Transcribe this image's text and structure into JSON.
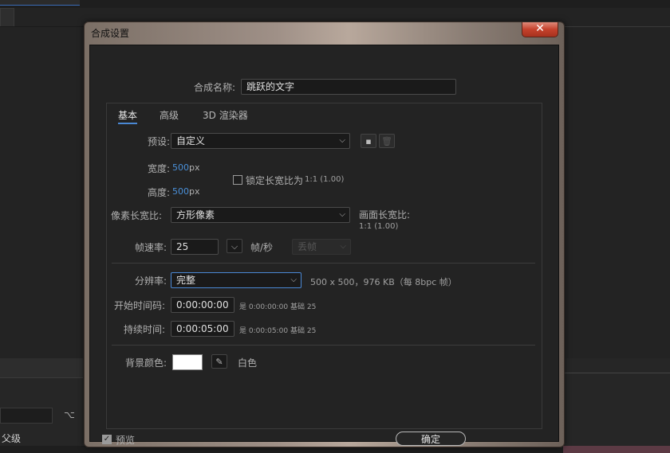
{
  "background": {
    "parent_label": "父级"
  },
  "dialog": {
    "title": "合成设置",
    "close_glyph": "✕",
    "comp_name_label": "合成名称:",
    "comp_name_value": "跳跃的文字",
    "tabs": [
      {
        "label": "基本",
        "active": true
      },
      {
        "label": "高级",
        "active": false
      },
      {
        "label": "3D 渲染器",
        "active": false
      }
    ],
    "preset_label": "预设:",
    "preset_value": "自定义",
    "width_label": "宽度:",
    "width_value": "500",
    "width_unit": "px",
    "height_label": "高度:",
    "height_value": "500",
    "height_unit": "px",
    "lock_aspect_label": "锁定长宽比为",
    "lock_aspect_value": "1:1 (1.00)",
    "pixel_aspect_label": "像素长宽比:",
    "pixel_aspect_value": "方形像素",
    "frame_aspect_label": "画面长宽比:",
    "frame_aspect_value": "1:1 (1.00)",
    "frame_rate_label": "帧速率:",
    "frame_rate_value": "25",
    "frame_rate_unit": "帧/秒",
    "drop_frame_value": "丢帧",
    "resolution_label": "分辨率:",
    "resolution_value": "完整",
    "resolution_info": "500 x 500，976 KB（每 8bpc 帧）",
    "start_tc_label": "开始时间码:",
    "start_tc_value": "0:00:00:00",
    "start_tc_info": "是 0:00:00:00",
    "start_tc_base": "基础 25",
    "duration_label": "持续时间:",
    "duration_value": "0:00:05:00",
    "duration_info": "是 0:00:05:00",
    "duration_base": "基础 25",
    "bg_color_label": "背景颜色:",
    "bg_color_hex": "#FFFFFF",
    "bg_color_name": "白色",
    "preview_label": "预览",
    "ok_label": "确定"
  }
}
